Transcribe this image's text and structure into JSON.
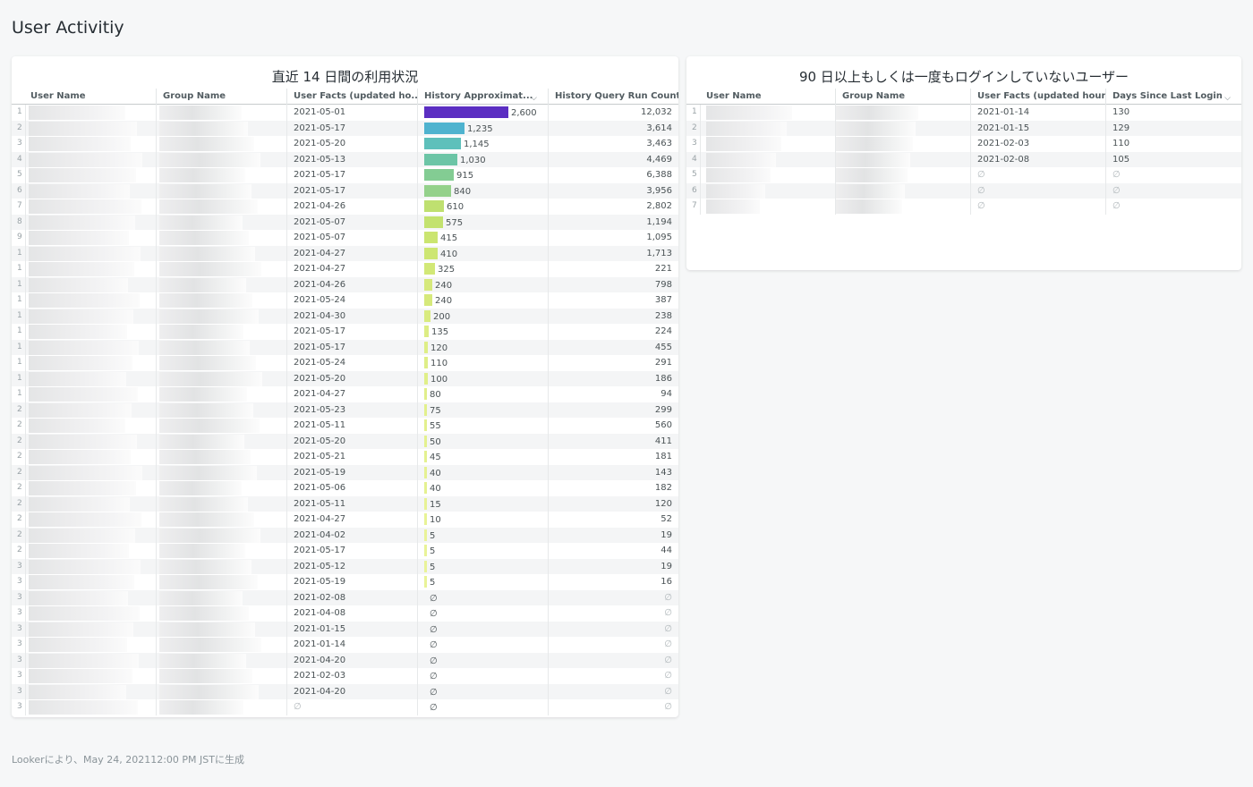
{
  "dashboard": {
    "title": "User Activitiy",
    "footer": "Lookerにより、May 24, 202112:00 PM JSTに生成"
  },
  "tile1": {
    "title": "直近 14 日間の利用状況",
    "columns": [
      "User Name",
      "Group Name",
      "User Facts (updated ho...",
      "History Approximat...",
      "History Query Run Count"
    ],
    "bar_max": 2600,
    "rows": [
      {
        "idx": "1",
        "date": "2021-05-01",
        "approx": 2600,
        "approx_label": "2,600",
        "count": "12,032",
        "color": "#5b2ec2"
      },
      {
        "idx": "2",
        "date": "2021-05-17",
        "approx": 1235,
        "approx_label": "1,235",
        "count": "3,614",
        "color": "#4fb3cf"
      },
      {
        "idx": "3",
        "date": "2021-05-20",
        "approx": 1145,
        "approx_label": "1,145",
        "count": "3,463",
        "color": "#5ec0bb"
      },
      {
        "idx": "4",
        "date": "2021-05-13",
        "approx": 1030,
        "approx_label": "1,030",
        "count": "4,469",
        "color": "#6cc5a6"
      },
      {
        "idx": "5",
        "date": "2021-05-17",
        "approx": 915,
        "approx_label": "915",
        "count": "6,388",
        "color": "#83cc93"
      },
      {
        "idx": "6",
        "date": "2021-05-17",
        "approx": 840,
        "approx_label": "840",
        "count": "3,956",
        "color": "#94d18b"
      },
      {
        "idx": "7",
        "date": "2021-04-26",
        "approx": 610,
        "approx_label": "610",
        "count": "2,802",
        "color": "#bfe070"
      },
      {
        "idx": "8",
        "date": "2021-05-07",
        "approx": 575,
        "approx_label": "575",
        "count": "1,194",
        "color": "#c3e26e"
      },
      {
        "idx": "9",
        "date": "2021-05-07",
        "approx": 415,
        "approx_label": "415",
        "count": "1,095",
        "color": "#cbe570"
      },
      {
        "idx": "1",
        "date": "2021-04-27",
        "approx": 410,
        "approx_label": "410",
        "count": "1,713",
        "color": "#cde672"
      },
      {
        "idx": "1",
        "date": "2021-04-27",
        "approx": 325,
        "approx_label": "325",
        "count": "221",
        "color": "#d2e877"
      },
      {
        "idx": "1",
        "date": "2021-04-26",
        "approx": 240,
        "approx_label": "240",
        "count": "798",
        "color": "#d6e97b"
      },
      {
        "idx": "1",
        "date": "2021-05-24",
        "approx": 240,
        "approx_label": "240",
        "count": "387",
        "color": "#d6e97b"
      },
      {
        "idx": "1",
        "date": "2021-04-30",
        "approx": 200,
        "approx_label": "200",
        "count": "238",
        "color": "#d9eb7f"
      },
      {
        "idx": "1",
        "date": "2021-05-17",
        "approx": 135,
        "approx_label": "135",
        "count": "224",
        "color": "#dded84"
      },
      {
        "idx": "1",
        "date": "2021-05-17",
        "approx": 120,
        "approx_label": "120",
        "count": "455",
        "color": "#deee86"
      },
      {
        "idx": "1",
        "date": "2021-05-24",
        "approx": 110,
        "approx_label": "110",
        "count": "291",
        "color": "#dfee87"
      },
      {
        "idx": "1",
        "date": "2021-05-20",
        "approx": 100,
        "approx_label": "100",
        "count": "186",
        "color": "#e0ef89"
      },
      {
        "idx": "1",
        "date": "2021-04-27",
        "approx": 80,
        "approx_label": "80",
        "count": "94",
        "color": "#e1ef8b"
      },
      {
        "idx": "2",
        "date": "2021-05-23",
        "approx": 75,
        "approx_label": "75",
        "count": "299",
        "color": "#e2f08c"
      },
      {
        "idx": "2",
        "date": "2021-05-11",
        "approx": 55,
        "approx_label": "55",
        "count": "560",
        "color": "#e3f08e"
      },
      {
        "idx": "2",
        "date": "2021-05-20",
        "approx": 50,
        "approx_label": "50",
        "count": "411",
        "color": "#e4f18f"
      },
      {
        "idx": "2",
        "date": "2021-05-21",
        "approx": 45,
        "approx_label": "45",
        "count": "181",
        "color": "#e4f190"
      },
      {
        "idx": "2",
        "date": "2021-05-19",
        "approx": 40,
        "approx_label": "40",
        "count": "143",
        "color": "#e5f191"
      },
      {
        "idx": "2",
        "date": "2021-05-06",
        "approx": 40,
        "approx_label": "40",
        "count": "182",
        "color": "#e5f191"
      },
      {
        "idx": "2",
        "date": "2021-05-11",
        "approx": 15,
        "approx_label": "15",
        "count": "120",
        "color": "#e7f295"
      },
      {
        "idx": "2",
        "date": "2021-04-27",
        "approx": 10,
        "approx_label": "10",
        "count": "52",
        "color": "#e8f396"
      },
      {
        "idx": "2",
        "date": "2021-04-02",
        "approx": 5,
        "approx_label": "5",
        "count": "19",
        "color": "#e9f398"
      },
      {
        "idx": "2",
        "date": "2021-05-17",
        "approx": 5,
        "approx_label": "5",
        "count": "44",
        "color": "#e9f398"
      },
      {
        "idx": "3",
        "date": "2021-05-12",
        "approx": 5,
        "approx_label": "5",
        "count": "19",
        "color": "#e9f398"
      },
      {
        "idx": "3",
        "date": "2021-05-19",
        "approx": 5,
        "approx_label": "5",
        "count": "16",
        "color": "#e9f398"
      },
      {
        "idx": "3",
        "date": "2021-02-08",
        "approx": null,
        "approx_label": "∅",
        "count": "∅",
        "color": ""
      },
      {
        "idx": "3",
        "date": "2021-04-08",
        "approx": null,
        "approx_label": "∅",
        "count": "∅",
        "color": ""
      },
      {
        "idx": "3",
        "date": "2021-01-15",
        "approx": null,
        "approx_label": "∅",
        "count": "∅",
        "color": ""
      },
      {
        "idx": "3",
        "date": "2021-01-14",
        "approx": null,
        "approx_label": "∅",
        "count": "∅",
        "color": ""
      },
      {
        "idx": "3",
        "date": "2021-04-20",
        "approx": null,
        "approx_label": "∅",
        "count": "∅",
        "color": ""
      },
      {
        "idx": "3",
        "date": "2021-02-03",
        "approx": null,
        "approx_label": "∅",
        "count": "∅",
        "color": ""
      },
      {
        "idx": "3",
        "date": "2021-04-20",
        "approx": null,
        "approx_label": "∅",
        "count": "∅",
        "color": ""
      },
      {
        "idx": "3",
        "date": "∅",
        "approx": null,
        "approx_label": "∅",
        "count": "∅",
        "color": ""
      }
    ]
  },
  "tile2": {
    "title": "90 日以上もしくは一度もログインしていないユーザー",
    "columns": [
      "User Name",
      "Group Name",
      "User Facts (updated hour...",
      "Days Since Last Login"
    ],
    "rows": [
      {
        "idx": "1",
        "date": "2021-01-14",
        "days": "130"
      },
      {
        "idx": "2",
        "date": "2021-01-15",
        "days": "129"
      },
      {
        "idx": "3",
        "date": "2021-02-03",
        "days": "110"
      },
      {
        "idx": "4",
        "date": "2021-02-08",
        "days": "105"
      },
      {
        "idx": "5",
        "date": "∅",
        "days": "∅"
      },
      {
        "idx": "6",
        "date": "∅",
        "days": "∅"
      },
      {
        "idx": "7",
        "date": "∅",
        "days": "∅"
      }
    ]
  }
}
